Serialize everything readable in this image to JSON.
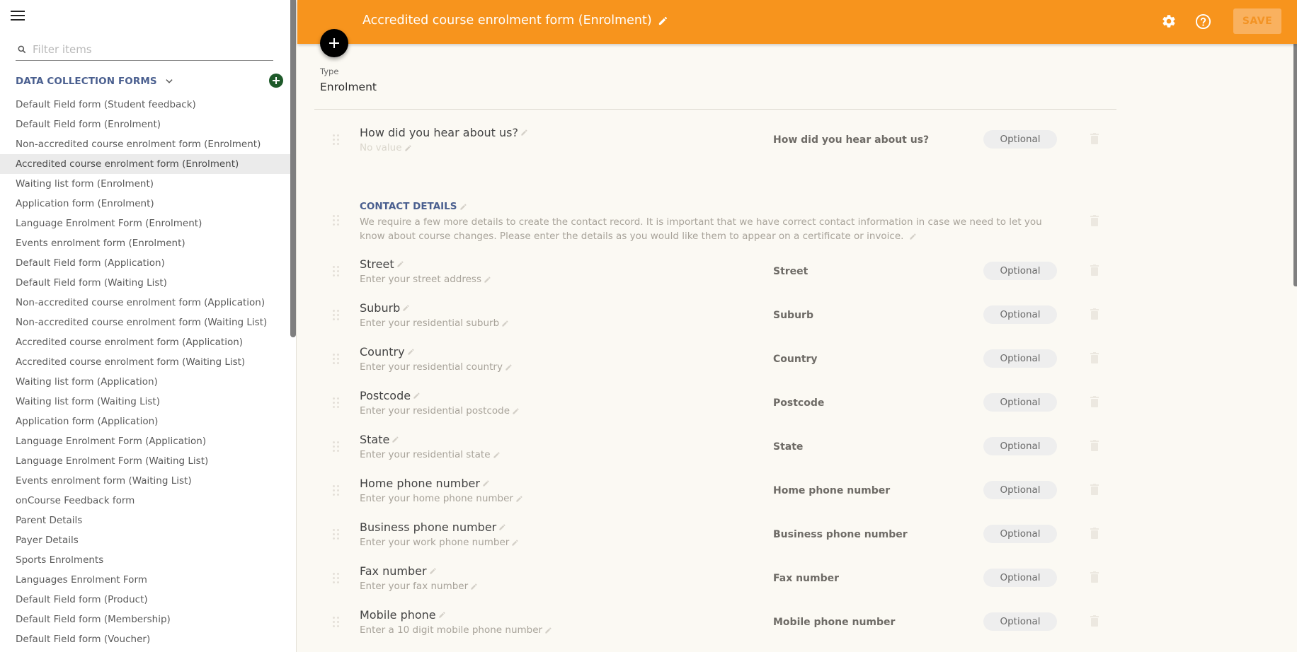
{
  "sidebar": {
    "menu_icon": "hamburger-menu-icon",
    "filter_placeholder": "Filter items",
    "filter_value": "",
    "section_title": "DATA COLLECTION FORMS",
    "active_index": 3,
    "items": [
      "Default Field form (Student feedback)",
      "Default Field form (Enrolment)",
      "Non-accredited course enrolment form (Enrolment)",
      "Accredited course enrolment form (Enrolment)",
      "Waiting list form (Enrolment)",
      "Application form (Enrolment)",
      "Language Enrolment Form (Enrolment)",
      "Events enrolment form (Enrolment)",
      "Default Field form (Application)",
      "Default Field form (Waiting List)",
      "Non-accredited course enrolment form (Application)",
      "Non-accredited course enrolment form (Waiting List)",
      "Accredited course enrolment form (Application)",
      "Accredited course enrolment form (Waiting List)",
      "Waiting list form (Application)",
      "Waiting list form (Waiting List)",
      "Application form (Application)",
      "Language Enrolment Form (Application)",
      "Language Enrolment Form (Waiting List)",
      "Events enrolment form (Waiting List)",
      "onCourse Feedback form",
      "Parent Details",
      "Payer Details",
      "Sports Enrolments",
      "Languages Enrolment Form",
      "Default Field form (Product)",
      "Default Field form (Membership)",
      "Default Field form (Voucher)"
    ]
  },
  "header": {
    "title": "Accredited course enrolment form (Enrolment)",
    "save_label": "SAVE",
    "accent_color": "#F7941D"
  },
  "form": {
    "type_label": "Type",
    "type_value": "Enrolment",
    "first_field": {
      "title": "How did you hear about us?",
      "hint": "No value",
      "name": "How did you hear about us?",
      "status": "Optional"
    },
    "heading": {
      "title": "CONTACT DETAILS",
      "description": "We require a few more details to create the contact record. It is important that we have correct contact information in case we need to let you know about course changes. Please enter the details as you would like them to appear on a certificate or invoice."
    },
    "fields": [
      {
        "title": "Street",
        "hint": "Enter your street address",
        "name": "Street",
        "status": "Optional"
      },
      {
        "title": "Suburb",
        "hint": "Enter your residential suburb",
        "name": "Suburb",
        "status": "Optional"
      },
      {
        "title": "Country",
        "hint": "Enter your residential country",
        "name": "Country",
        "status": "Optional"
      },
      {
        "title": "Postcode",
        "hint": "Enter your residential postcode",
        "name": "Postcode",
        "status": "Optional"
      },
      {
        "title": "State",
        "hint": "Enter your residential state",
        "name": "State",
        "status": "Optional"
      },
      {
        "title": "Home phone number",
        "hint": "Enter your home phone number",
        "name": "Home phone number",
        "status": "Optional"
      },
      {
        "title": "Business phone number",
        "hint": "Enter your work phone number",
        "name": "Business phone number",
        "status": "Optional"
      },
      {
        "title": "Fax number",
        "hint": "Enter your fax number",
        "name": "Fax number",
        "status": "Optional"
      },
      {
        "title": "Mobile phone",
        "hint": "Enter a 10 digit mobile phone number",
        "name": "Mobile phone number",
        "status": "Optional"
      }
    ]
  }
}
